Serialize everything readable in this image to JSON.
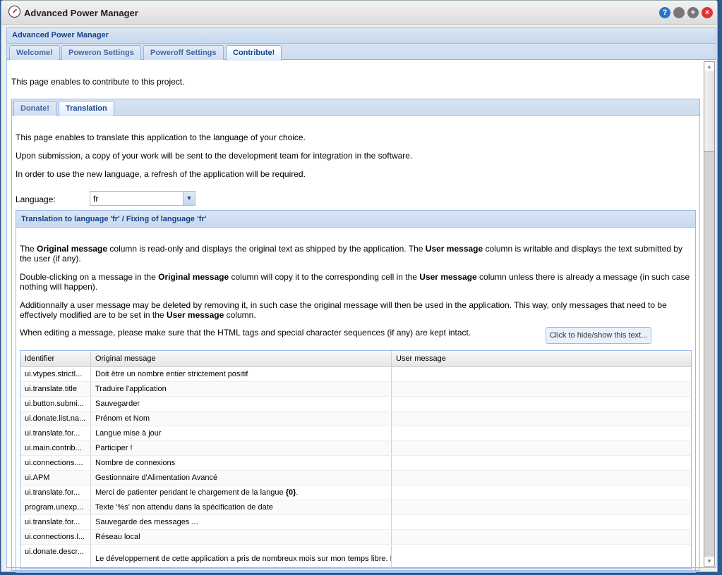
{
  "window": {
    "title": "Advanced Power Manager",
    "buttons": [
      "help",
      "minimize",
      "maximize",
      "close"
    ]
  },
  "panel": {
    "title": "Advanced Power Manager",
    "tabs": [
      {
        "label": "Welcome!"
      },
      {
        "label": "Poweron Settings"
      },
      {
        "label": "Poweroff Settings"
      },
      {
        "label": "Contribute!",
        "active": true
      }
    ]
  },
  "contribute": {
    "intro": "This page enables to contribute to this project.",
    "tabs": [
      {
        "label": "Donate!"
      },
      {
        "label": "Translation",
        "active": true
      }
    ]
  },
  "translation": {
    "p1": "This page enables to translate this application to the language of your choice.",
    "p2": "Upon submission, a copy of your work will be sent to the development team for integration in the software.",
    "p3": "In order to use the new language, a refresh of the application will be required.",
    "language_label": "Language:",
    "language_value": "fr",
    "fieldset_title": "Translation to language 'fr' / Fixing of language 'fr'",
    "help": {
      "a1": "The ",
      "a2": "Original message",
      "a3": " column is read-only and displays the original text as shipped by the application. The ",
      "a4": "User message",
      "a5": " column is writable and displays the text submitted by the user (if any).",
      "b1": "Double-clicking on a message in the ",
      "b2": "Original message",
      "b3": " column will copy it to the corresponding cell in the ",
      "b4": "User message",
      "b5": " column unless there is already a message (in such case nothing will happen).",
      "c1": "Additionnally a user message may be deleted by removing it, in such case the original message will then be used in the application. This way, only messages that need to be effectively modified are to be set in the ",
      "c2": "User message",
      "c3": " column.",
      "d": "When editing a message, please make sure that the HTML tags and special character sequences (if any) are kept intact."
    },
    "toggle_button": "Click to hide/show this text...",
    "grid": {
      "columns": [
        "Identifier",
        "Original message",
        "User message"
      ],
      "rows": [
        {
          "id": "ui.vtypes.strictl...",
          "original": "Doit être un nombre entier strictement positif",
          "user": ""
        },
        {
          "id": "ui.translate.title",
          "original": "Traduire l'application",
          "user": ""
        },
        {
          "id": "ui.button.submi...",
          "original": "Sauvegarder",
          "user": ""
        },
        {
          "id": "ui.donate.list.na...",
          "original": "Prénom et Nom",
          "user": ""
        },
        {
          "id": "ui.translate.for...",
          "original": "Langue mise à jour",
          "user": ""
        },
        {
          "id": "ui.main.contrib...",
          "original": "Participer !",
          "user": ""
        },
        {
          "id": "ui.connections....",
          "original": "Nombre de connexions",
          "user": ""
        },
        {
          "id": "ui.APM",
          "original": "Gestionnaire d'Alimentation Avancé",
          "user": ""
        },
        {
          "id": "ui.translate.for...",
          "original": "Merci de patienter pendant le chargement de la langue ",
          "original_bold": "{0}",
          "original_tail": ".",
          "user": ""
        },
        {
          "id": "program.unexp...",
          "original": "Texte '%s' non attendu dans la spécification de date",
          "user": ""
        },
        {
          "id": "ui.translate.for...",
          "original": "Sauvegarde des messages ...",
          "user": ""
        },
        {
          "id": "ui.connections.l...",
          "original": "Réseau local",
          "user": ""
        },
        {
          "id": "ui.donate.descr...",
          "original": "Le développement de cette application a pris de nombreux mois sur mon temps libre. L",
          "user": ""
        }
      ]
    }
  }
}
